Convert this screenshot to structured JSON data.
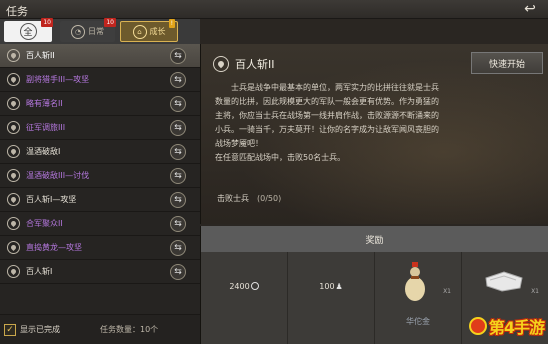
{
  "header": {
    "title": "任务",
    "back_icon": "return-arrow-icon"
  },
  "tabs": [
    {
      "label": "全",
      "icon": "all-circle-icon",
      "selected": true,
      "badge": "10"
    },
    {
      "label": "日常",
      "icon": "daily-icon",
      "selected": false,
      "badge": "10"
    },
    {
      "label": "成长",
      "icon": "growth-icon",
      "selected": false,
      "badge": "!"
    }
  ],
  "quest_list": [
    {
      "label": "百人斩II",
      "color": "white",
      "selected": true
    },
    {
      "label": "副将猎手III—攻坚",
      "color": "purple",
      "selected": false
    },
    {
      "label": "略有薄名II",
      "color": "purple",
      "selected": false
    },
    {
      "label": "征军调旅III",
      "color": "purple",
      "selected": false
    },
    {
      "label": "温酒破敌I",
      "color": "white",
      "selected": false
    },
    {
      "label": "温酒破敌III—讨伐",
      "color": "purple",
      "selected": false
    },
    {
      "label": "百人斩I—攻坚",
      "color": "white",
      "selected": false
    },
    {
      "label": "合军聚众II",
      "color": "purple",
      "selected": false
    },
    {
      "label": "直捣黄龙—攻坚",
      "color": "purple",
      "selected": false
    },
    {
      "label": "百人斩I",
      "color": "white",
      "selected": false
    }
  ],
  "footer": {
    "show_completed_label": "显示已完成",
    "show_completed_checked": true,
    "task_count_label": "任务数量：10个"
  },
  "detail": {
    "title": "百人斩II",
    "quick_start_label": "快速开始",
    "description_lines": [
      "　　士兵是战争中最基本的单位，两军实力的比拼往往就是士兵",
      "数量的比拼，因此规模更大的军队一般会更有优势。作为勇猛的",
      "主将，你应当士兵在战场第一线并肩作战，击败源源不断涌来的",
      "小兵。一骑当千，万夫莫开！让你的名字成为让敌军闻风丧胆的",
      "战场梦魇吧！",
      "在任意匹配战场中，击败50名士兵。"
    ],
    "objective_label": "击败士兵",
    "objective_progress": "(0/50)"
  },
  "rewards": {
    "header": "奖励",
    "items": [
      {
        "amount": "2400",
        "icon": "coin-icon"
      },
      {
        "amount": "100",
        "icon": "person-icon"
      },
      {
        "name": "华佗金",
        "qty": "X1",
        "icon": "gourd-item-icon"
      },
      {
        "name": "",
        "qty": "X1",
        "icon": "cloth-item-icon"
      }
    ]
  },
  "watermark": {
    "text": "第4手游"
  }
}
